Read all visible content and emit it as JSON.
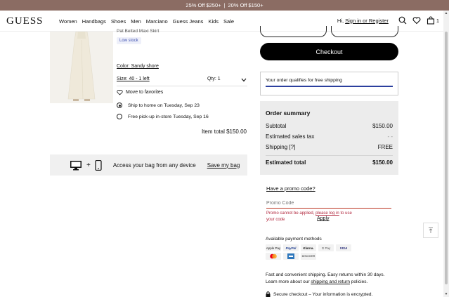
{
  "promo_bar": {
    "left": "25% Off $250+",
    "separator": "|",
    "right": "20% Off $150+"
  },
  "header": {
    "logo": "GUESS",
    "nav": [
      "Women",
      "Handbags",
      "Shoes",
      "Men",
      "Marciano",
      "Guess Jeans",
      "Kids",
      "Sale"
    ],
    "greeting": "Hi,",
    "signin": "Sign in or Register",
    "cart_count": "1"
  },
  "product": {
    "name": "Pat Belted Maxi Skirt",
    "stock_badge": "Low stock",
    "color": "Color: Sandy shore",
    "size": "Size: 40 - 1 left",
    "qty": "Qty: 1",
    "move_to_favorites": "Move to favorites",
    "ship_home": "Ship to home on Tuesday, Sep 23",
    "pickup": "Free pick-up in-store Tuesday, Sep 16",
    "item_total": "Item total $150.00"
  },
  "save_bag": {
    "text": "Access your bag from any device",
    "link": "Save my bag",
    "plus": "+"
  },
  "checkout": {
    "label": "Checkout"
  },
  "free_shipping": {
    "text": "Your order qualifies for free shipping",
    "progress": 1.0
  },
  "summary": {
    "title": "Order summary",
    "rows": [
      {
        "label": "Subtotal",
        "value": "$150.00"
      },
      {
        "label": "Estimated sales tax",
        "value": "- -"
      },
      {
        "label": "Shipping [?]",
        "value": "FREE"
      }
    ],
    "total_label": "Estimated total",
    "total_value": "$150.00"
  },
  "promo": {
    "link": "Have a promo code?",
    "placeholder": "Promo Code",
    "error_1": "Promo cannot be applied,",
    "error_link": "please log in",
    "error_2": "to use your code",
    "apply": "Apply"
  },
  "payments": {
    "title": "Available payment methods",
    "methods": [
      "Apple Pay",
      "PayPal",
      "Klarna.",
      "G Pay",
      "VISA",
      "Mastercard",
      "Amex",
      "DISCOVER"
    ]
  },
  "shipping_note": {
    "line1": "Fast and convenient shipping. Easy returns within 30 days.",
    "line2_pre": "Learn more about our",
    "line2_link": "shipping and return",
    "line2_post": "policies."
  },
  "secure": {
    "text": "Secure checkout – Your information is encrypted."
  },
  "colors": {
    "promo_bar": "#8b6c63",
    "accent": "#2c3f9e",
    "error": "#b0233a"
  }
}
